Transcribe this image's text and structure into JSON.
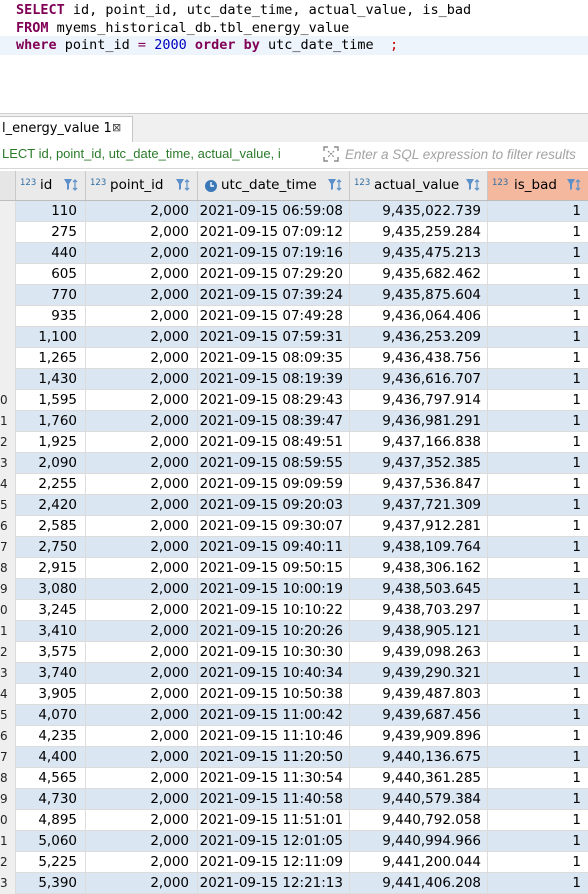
{
  "editor": {
    "line1": {
      "kw1": "SELECT",
      "rest": " id, point_id, utc_date_time, actual_value, is_bad"
    },
    "line2": {
      "kw1": "FROM",
      "rest": " myems_historical_db.tbl_energy_value"
    },
    "line3": {
      "kw1": "where",
      "mid1": " point_id ",
      "op": "=",
      "sp": " ",
      "num": "2000",
      "sp2": " ",
      "kw2": "order by",
      "mid2": " utc_date_time  ",
      "semi": ";"
    }
  },
  "result_tab": {
    "label": "l_energy_value 1",
    "close": "⊠"
  },
  "filter": {
    "query_text": "LECT id, point_id, utc_date_time, actual_value, i",
    "placeholder": "Enter a SQL expression to filter results"
  },
  "columns": [
    {
      "type": "123",
      "name": "id"
    },
    {
      "type": "123",
      "name": "point_id"
    },
    {
      "type": "",
      "name": "utc_date_time"
    },
    {
      "type": "123",
      "name": "actual_value"
    },
    {
      "type": "123",
      "name": "is_bad"
    }
  ],
  "colors": {
    "selected_header": "#f4b89e",
    "row_stripe": "#dbe6f3",
    "keyword": "#7f0055",
    "number": "#0000c0"
  },
  "rows": [
    {
      "rn": "",
      "id": "110",
      "point_id": "2,000",
      "utc_date_time": "2021-09-15 06:59:08",
      "actual_value": "9,435,022.739",
      "is_bad": "1"
    },
    {
      "rn": "",
      "id": "275",
      "point_id": "2,000",
      "utc_date_time": "2021-09-15 07:09:12",
      "actual_value": "9,435,259.284",
      "is_bad": "1"
    },
    {
      "rn": "",
      "id": "440",
      "point_id": "2,000",
      "utc_date_time": "2021-09-15 07:19:16",
      "actual_value": "9,435,475.213",
      "is_bad": "1"
    },
    {
      "rn": "",
      "id": "605",
      "point_id": "2,000",
      "utc_date_time": "2021-09-15 07:29:20",
      "actual_value": "9,435,682.462",
      "is_bad": "1"
    },
    {
      "rn": "",
      "id": "770",
      "point_id": "2,000",
      "utc_date_time": "2021-09-15 07:39:24",
      "actual_value": "9,435,875.604",
      "is_bad": "1"
    },
    {
      "rn": "",
      "id": "935",
      "point_id": "2,000",
      "utc_date_time": "2021-09-15 07:49:28",
      "actual_value": "9,436,064.406",
      "is_bad": "1"
    },
    {
      "rn": "",
      "id": "1,100",
      "point_id": "2,000",
      "utc_date_time": "2021-09-15 07:59:31",
      "actual_value": "9,436,253.209",
      "is_bad": "1"
    },
    {
      "rn": "",
      "id": "1,265",
      "point_id": "2,000",
      "utc_date_time": "2021-09-15 08:09:35",
      "actual_value": "9,436,438.756",
      "is_bad": "1"
    },
    {
      "rn": "",
      "id": "1,430",
      "point_id": "2,000",
      "utc_date_time": "2021-09-15 08:19:39",
      "actual_value": "9,436,616.707",
      "is_bad": "1"
    },
    {
      "rn": "0",
      "id": "1,595",
      "point_id": "2,000",
      "utc_date_time": "2021-09-15 08:29:43",
      "actual_value": "9,436,797.914",
      "is_bad": "1"
    },
    {
      "rn": "1",
      "id": "1,760",
      "point_id": "2,000",
      "utc_date_time": "2021-09-15 08:39:47",
      "actual_value": "9,436,981.291",
      "is_bad": "1"
    },
    {
      "rn": "2",
      "id": "1,925",
      "point_id": "2,000",
      "utc_date_time": "2021-09-15 08:49:51",
      "actual_value": "9,437,166.838",
      "is_bad": "1"
    },
    {
      "rn": "3",
      "id": "2,090",
      "point_id": "2,000",
      "utc_date_time": "2021-09-15 08:59:55",
      "actual_value": "9,437,352.385",
      "is_bad": "1"
    },
    {
      "rn": "4",
      "id": "2,255",
      "point_id": "2,000",
      "utc_date_time": "2021-09-15 09:09:59",
      "actual_value": "9,437,536.847",
      "is_bad": "1"
    },
    {
      "rn": "5",
      "id": "2,420",
      "point_id": "2,000",
      "utc_date_time": "2021-09-15 09:20:03",
      "actual_value": "9,437,721.309",
      "is_bad": "1"
    },
    {
      "rn": "6",
      "id": "2,585",
      "point_id": "2,000",
      "utc_date_time": "2021-09-15 09:30:07",
      "actual_value": "9,437,912.281",
      "is_bad": "1"
    },
    {
      "rn": "7",
      "id": "2,750",
      "point_id": "2,000",
      "utc_date_time": "2021-09-15 09:40:11",
      "actual_value": "9,438,109.764",
      "is_bad": "1"
    },
    {
      "rn": "8",
      "id": "2,915",
      "point_id": "2,000",
      "utc_date_time": "2021-09-15 09:50:15",
      "actual_value": "9,438,306.162",
      "is_bad": "1"
    },
    {
      "rn": "9",
      "id": "3,080",
      "point_id": "2,000",
      "utc_date_time": "2021-09-15 10:00:19",
      "actual_value": "9,438,503.645",
      "is_bad": "1"
    },
    {
      "rn": "0",
      "id": "3,245",
      "point_id": "2,000",
      "utc_date_time": "2021-09-15 10:10:22",
      "actual_value": "9,438,703.297",
      "is_bad": "1"
    },
    {
      "rn": "1",
      "id": "3,410",
      "point_id": "2,000",
      "utc_date_time": "2021-09-15 10:20:26",
      "actual_value": "9,438,905.121",
      "is_bad": "1"
    },
    {
      "rn": "2",
      "id": "3,575",
      "point_id": "2,000",
      "utc_date_time": "2021-09-15 10:30:30",
      "actual_value": "9,439,098.263",
      "is_bad": "1"
    },
    {
      "rn": "3",
      "id": "3,740",
      "point_id": "2,000",
      "utc_date_time": "2021-09-15 10:40:34",
      "actual_value": "9,439,290.321",
      "is_bad": "1"
    },
    {
      "rn": "4",
      "id": "3,905",
      "point_id": "2,000",
      "utc_date_time": "2021-09-15 10:50:38",
      "actual_value": "9,439,487.803",
      "is_bad": "1"
    },
    {
      "rn": "5",
      "id": "4,070",
      "point_id": "2,000",
      "utc_date_time": "2021-09-15 11:00:42",
      "actual_value": "9,439,687.456",
      "is_bad": "1"
    },
    {
      "rn": "6",
      "id": "4,235",
      "point_id": "2,000",
      "utc_date_time": "2021-09-15 11:10:46",
      "actual_value": "9,439,909.896",
      "is_bad": "1"
    },
    {
      "rn": "7",
      "id": "4,400",
      "point_id": "2,000",
      "utc_date_time": "2021-09-15 11:20:50",
      "actual_value": "9,440,136.675",
      "is_bad": "1"
    },
    {
      "rn": "8",
      "id": "4,565",
      "point_id": "2,000",
      "utc_date_time": "2021-09-15 11:30:54",
      "actual_value": "9,440,361.285",
      "is_bad": "1"
    },
    {
      "rn": "9",
      "id": "4,730",
      "point_id": "2,000",
      "utc_date_time": "2021-09-15 11:40:58",
      "actual_value": "9,440,579.384",
      "is_bad": "1"
    },
    {
      "rn": "0",
      "id": "4,895",
      "point_id": "2,000",
      "utc_date_time": "2021-09-15 11:51:01",
      "actual_value": "9,440,792.058",
      "is_bad": "1"
    },
    {
      "rn": "1",
      "id": "5,060",
      "point_id": "2,000",
      "utc_date_time": "2021-09-15 12:01:05",
      "actual_value": "9,440,994.966",
      "is_bad": "1"
    },
    {
      "rn": "2",
      "id": "5,225",
      "point_id": "2,000",
      "utc_date_time": "2021-09-15 12:11:09",
      "actual_value": "9,441,200.044",
      "is_bad": "1"
    },
    {
      "rn": "3",
      "id": "5,390",
      "point_id": "2,000",
      "utc_date_time": "2021-09-15 12:21:13",
      "actual_value": "9,441,406.208",
      "is_bad": "1"
    }
  ]
}
